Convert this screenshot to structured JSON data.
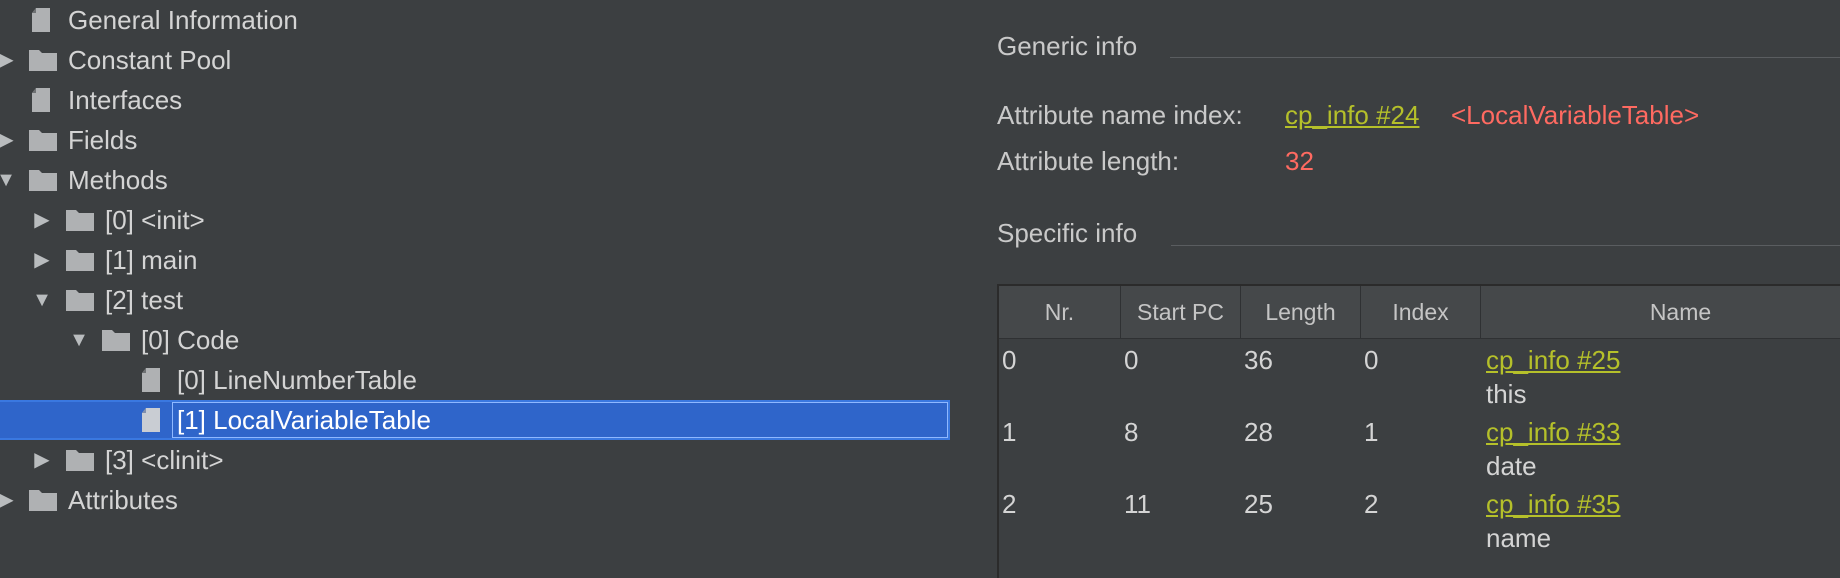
{
  "tree": {
    "items": [
      {
        "label": "General Information",
        "icon": "file-icon",
        "arrow": ""
      },
      {
        "label": "Constant Pool",
        "icon": "folder-icon",
        "arrow": "right"
      },
      {
        "label": "Interfaces",
        "icon": "file-icon",
        "arrow": ""
      },
      {
        "label": "Fields",
        "icon": "folder-icon",
        "arrow": "right"
      },
      {
        "label": "Methods",
        "icon": "folder-icon",
        "arrow": "down"
      },
      {
        "label": "[0] <init>",
        "icon": "folder-icon",
        "arrow": "right"
      },
      {
        "label": "[1] main",
        "icon": "folder-icon",
        "arrow": "right"
      },
      {
        "label": "[2] test",
        "icon": "folder-icon",
        "arrow": "down"
      },
      {
        "label": "[0] Code",
        "icon": "folder-icon",
        "arrow": "down"
      },
      {
        "label": "[0] LineNumberTable",
        "icon": "file-icon",
        "arrow": ""
      },
      {
        "label": "[1] LocalVariableTable",
        "icon": "file-icon",
        "arrow": ""
      },
      {
        "label": "[3] <clinit>",
        "icon": "folder-icon",
        "arrow": "right"
      },
      {
        "label": "Attributes",
        "icon": "folder-icon",
        "arrow": "right"
      }
    ],
    "selected_label": "[1] LocalVariableTable"
  },
  "details": {
    "generic_title": "Generic info",
    "attr_name_index_label": "Attribute name index:",
    "attr_name_index_link": "cp_info #24",
    "attr_name_index_value": "<LocalVariableTable>",
    "attr_length_label": "Attribute length:",
    "attr_length_value": "32",
    "specific_title": "Specific info",
    "table": {
      "headers": [
        "Nr.",
        "Start PC",
        "Length",
        "Index",
        "Name"
      ],
      "rows": [
        {
          "nr": "0",
          "start_pc": "0",
          "length": "36",
          "index": "0",
          "name_link": "cp_info #25",
          "name_value": "this"
        },
        {
          "nr": "1",
          "start_pc": "8",
          "length": "28",
          "index": "1",
          "name_link": "cp_info #33",
          "name_value": "date"
        },
        {
          "nr": "2",
          "start_pc": "11",
          "length": "25",
          "index": "2",
          "name_link": "cp_info #35",
          "name_value": "name"
        }
      ]
    }
  },
  "colors": {
    "background": "#3c3f41",
    "selection": "#2f65ca",
    "link": "#b5c02a",
    "value_red": "#ff6a61"
  }
}
